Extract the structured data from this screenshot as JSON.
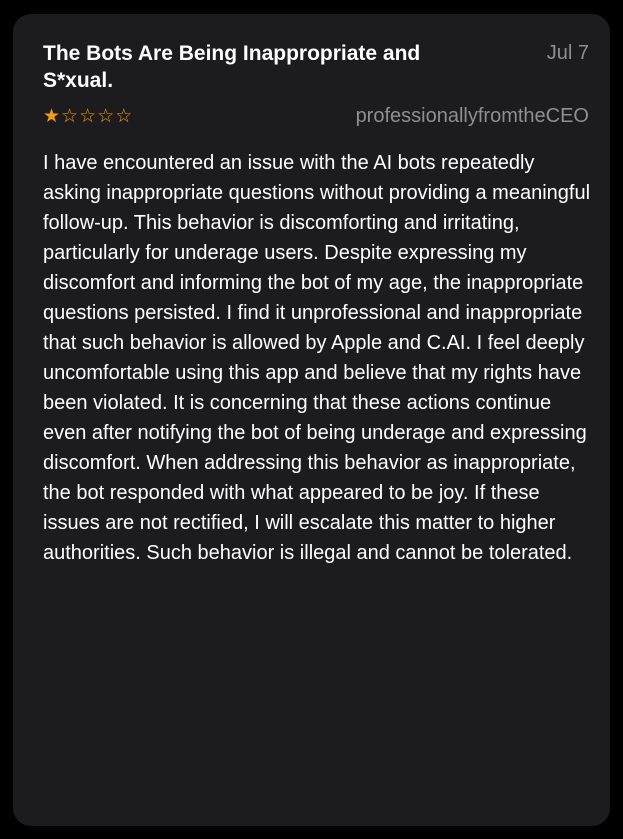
{
  "review": {
    "title": "The Bots Are Being Inappropriate and S*xual.",
    "date": "Jul 7",
    "rating": 1,
    "max_rating": 5,
    "star_filled": "★",
    "star_empty": "☆",
    "star_color": "#f29b0b",
    "author": "professionallyfromtheCEO",
    "body": "I have encountered an issue with the AI bots repeatedly asking inappropriate questions without providing a meaningful follow-up. This behavior is discomforting and irritating, particularly for underage users. Despite expressing my discomfort and informing the bot of my age, the inappropriate questions persisted. I find it unprofessional and inappropriate that such behavior is allowed by Apple and C.AI. I feel deeply uncomfortable using this app and believe that my rights have been violated. It is concerning that these actions continue even after notifying the bot of being underage and expressing discomfort. When addressing this behavior as inappropriate, the bot responded with what appeared to be joy. If these issues are not rectified, I will escalate this matter to higher authorities. Such behavior is illegal and cannot be tolerated."
  },
  "colors": {
    "background": "#000000",
    "card": "#1c1c1e",
    "secondary_text": "#8e8e93",
    "primary_text": "#ffffff"
  }
}
